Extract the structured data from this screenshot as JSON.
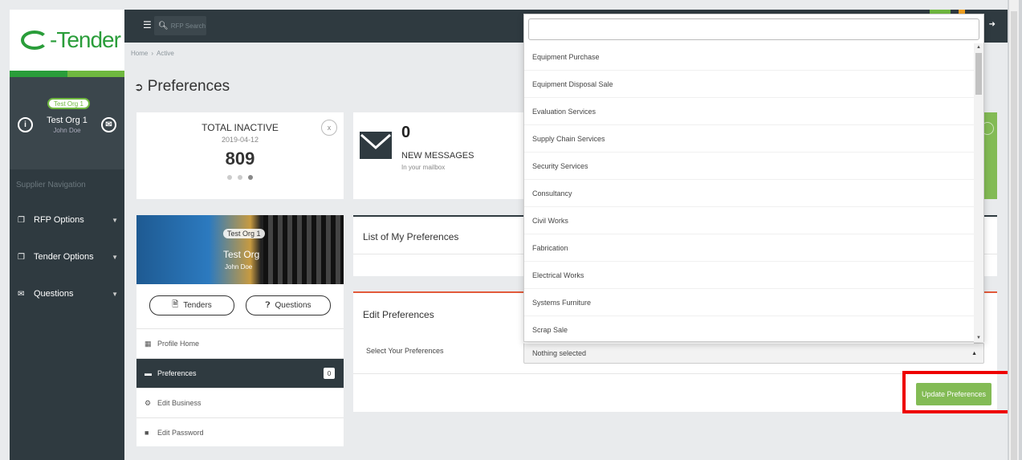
{
  "app": {
    "logo_text": "-Tender"
  },
  "sidebar": {
    "org_pill": "Test Org 1",
    "profile_name": "Test Org 1",
    "profile_user": "John Doe",
    "nav_title": "Supplier Navigation",
    "items": [
      {
        "label": "RFP Options",
        "icon": "copy-icon"
      },
      {
        "label": "Tender Options",
        "icon": "copy-icon"
      },
      {
        "label": "Questions",
        "icon": "envelope-icon"
      }
    ]
  },
  "topbar": {
    "search_placeholder": "RFP Search"
  },
  "breadcrumb": {
    "home": "Home",
    "current": "Active"
  },
  "page": {
    "title": "Preferences"
  },
  "stat_card": {
    "title": "TOTAL INACTIVE",
    "date": "2019-04-12",
    "value": "809",
    "close": "x"
  },
  "messages_card": {
    "count": "0",
    "label": "NEW MESSAGES",
    "sub": "In your mailbox"
  },
  "profile_card": {
    "org_image_alt": "Test Org 1",
    "org": "Test Org",
    "user": "John Doe",
    "tenders_btn": "Tenders",
    "questions_btn": "Questions",
    "menu": [
      {
        "label": "Profile Home",
        "icon": "chart-icon"
      },
      {
        "label": "Preferences",
        "icon": "book-icon",
        "badge": "0"
      },
      {
        "label": "Edit Business",
        "icon": "gear-icon"
      },
      {
        "label": "Edit Password",
        "icon": "folder-icon"
      }
    ]
  },
  "list_card": {
    "title": "List of My Preferences"
  },
  "edit_card": {
    "title": "Edit Preferences",
    "label": "Select Your Preferences",
    "selected": "Nothing selected",
    "update_button": "Update Preferences"
  },
  "dropdown": {
    "search_value": "",
    "options": [
      "Equipment Purchase",
      "Equipment Disposal Sale",
      "Evaluation Services",
      "Supply Chain Services",
      "Security Services",
      "Consultancy",
      "Civil Works",
      "Fabrication",
      "Electrical Works",
      "Systems Furniture",
      "Scrap Sale"
    ]
  },
  "colors": {
    "dark": "#2f3a40",
    "green": "#83bb55",
    "brand_green": "#2a9d3a",
    "highlight": "#e00000",
    "edit_accent": "#e25a3a"
  }
}
